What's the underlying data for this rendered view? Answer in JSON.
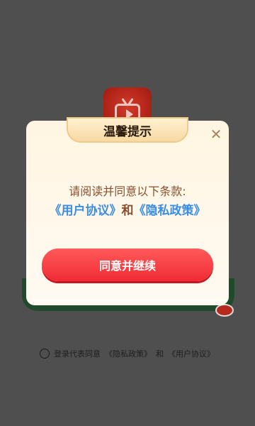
{
  "login_screen": {
    "terms_prefix": "登录代表同意",
    "privacy_link": "《隐私政策》",
    "and_text": "和",
    "user_agreement_link": "《用户协议》"
  },
  "dialog": {
    "title": "温馨提示",
    "close_glyph": "✕",
    "message": "请阅读并同意以下条款:",
    "user_agreement_link": "《用户协议》",
    "and_text": "和",
    "privacy_link": "《隐私政策》",
    "agree_button": "同意并继续"
  },
  "colors": {
    "link_blue": "#3a8ee8",
    "button_red": "#f02b36",
    "message_brown": "#8a5030"
  },
  "icons": [
    "tv-play-icon",
    "close-icon",
    "radio-unchecked-icon"
  ]
}
